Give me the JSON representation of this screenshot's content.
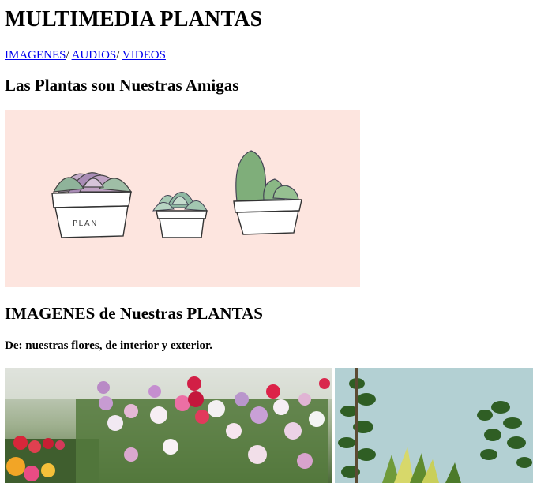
{
  "page": {
    "title": "MULTIMEDIA PLANTAS",
    "nav": [
      {
        "label": "IMAGENES",
        "sep": "/ "
      },
      {
        "label": "AUDIOS",
        "sep": "/ "
      },
      {
        "label": "VIDEOS",
        "sep": ""
      }
    ],
    "heading_1": "Las Plantas son Nuestras Amigas",
    "hero": {
      "pot_text": "PLAN",
      "bg_color": "#fde5df"
    },
    "heading_2": "IMAGENES de Nuestras PLANTAS",
    "subtitle": "De: nuestras flores, de interior y exterior."
  }
}
